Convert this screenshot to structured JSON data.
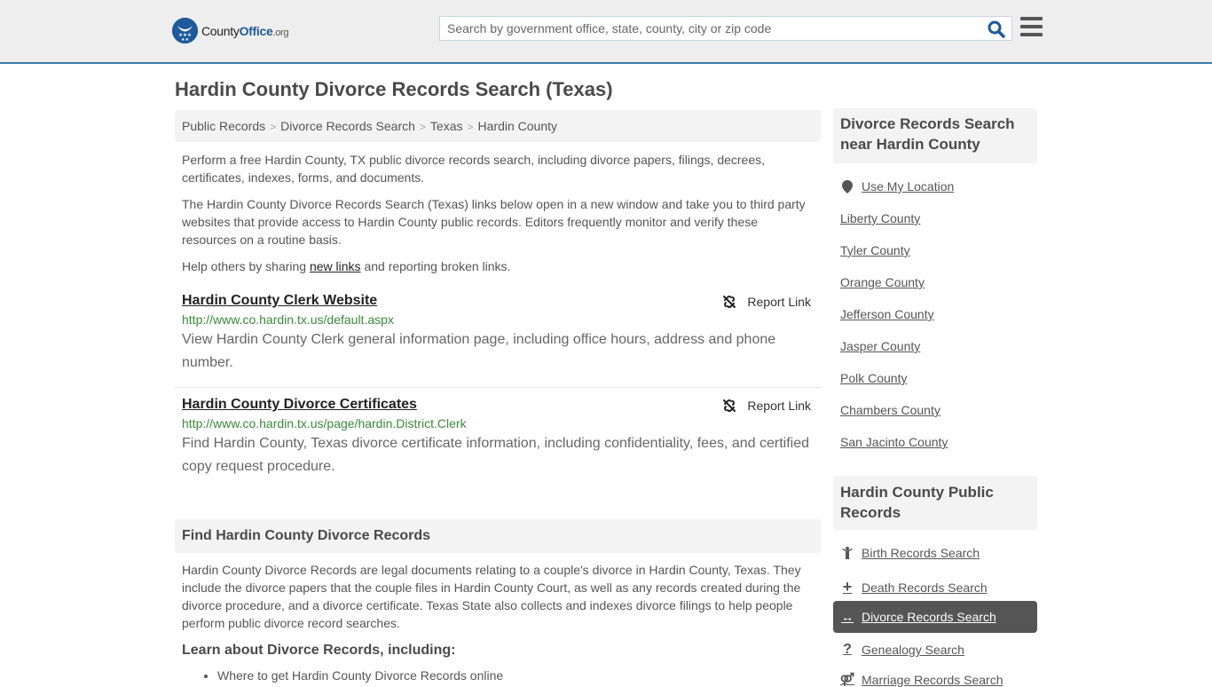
{
  "header": {
    "logo": {
      "county": "County",
      "office": "Office",
      "org": ".org"
    },
    "search": {
      "placeholder": "Search by government office, state, county, city or zip code",
      "value": ""
    },
    "icons": {
      "search": "search-icon",
      "menu": "hamburger-menu-icon"
    }
  },
  "main": {
    "title": "Hardin County Divorce Records Search (Texas)",
    "breadcrumb": [
      "Public Records",
      "Divorce Records Search",
      "Texas",
      "Hardin County"
    ],
    "intro": {
      "p1": "Perform a free Hardin County, TX public divorce records search, including divorce papers, filings, decrees, certificates, indexes, forms, and documents.",
      "p2": "The Hardin County Divorce Records Search (Texas) links below open in a new window and take you to third party websites that provide access to Hardin County public records. Editors frequently monitor and verify these resources on a routine basis.",
      "p3_before": "Help others by sharing ",
      "p3_link": "new links",
      "p3_after": " and reporting broken links."
    },
    "links": [
      {
        "title": "Hardin County Clerk Website",
        "url": "http://www.co.hardin.tx.us/default.aspx",
        "description": "View Hardin County Clerk general information page, including office hours, address and phone number.",
        "report": "Report Link"
      },
      {
        "title": "Hardin County Divorce Certificates",
        "url": "http://www.co.hardin.tx.us/page/hardin.District.Clerk",
        "description": "Find Hardin County, Texas divorce certificate information, including confidentiality, fees, and certified copy request procedure.",
        "report": "Report Link"
      }
    ],
    "find_section": {
      "heading": "Find Hardin County Divorce Records",
      "body": "Hardin County Divorce Records are legal documents relating to a couple's divorce in Hardin County, Texas. They include the divorce papers that the couple files in Hardin County Court, as well as any records created during the divorce procedure, and a divorce certificate. Texas State also collects and indexes divorce filings to help people perform public divorce record searches.",
      "learn_heading": "Learn about Divorce Records, including:",
      "bullets": [
        "Where to get Hardin County Divorce Records online"
      ]
    }
  },
  "sidebar": {
    "nearby": {
      "heading": "Divorce Records Search near Hardin County",
      "use_location": "Use My Location",
      "counties": [
        "Liberty County",
        "Tyler County",
        "Orange County",
        "Jefferson County",
        "Jasper County",
        "Polk County",
        "Chambers County",
        "San Jacinto County"
      ]
    },
    "public_records": {
      "heading": "Hardin County Public Records",
      "items": [
        {
          "label": "Birth Records Search",
          "icon": "person-icon"
        },
        {
          "label": "Death Records Search",
          "icon": "plus-icon"
        },
        {
          "label": "Divorce Records Search",
          "icon": "double-arrow-icon",
          "active": true
        },
        {
          "label": "Genealogy Search",
          "icon": "question-icon"
        },
        {
          "label": "Marriage Records Search",
          "icon": "marriage-icon"
        }
      ]
    }
  }
}
